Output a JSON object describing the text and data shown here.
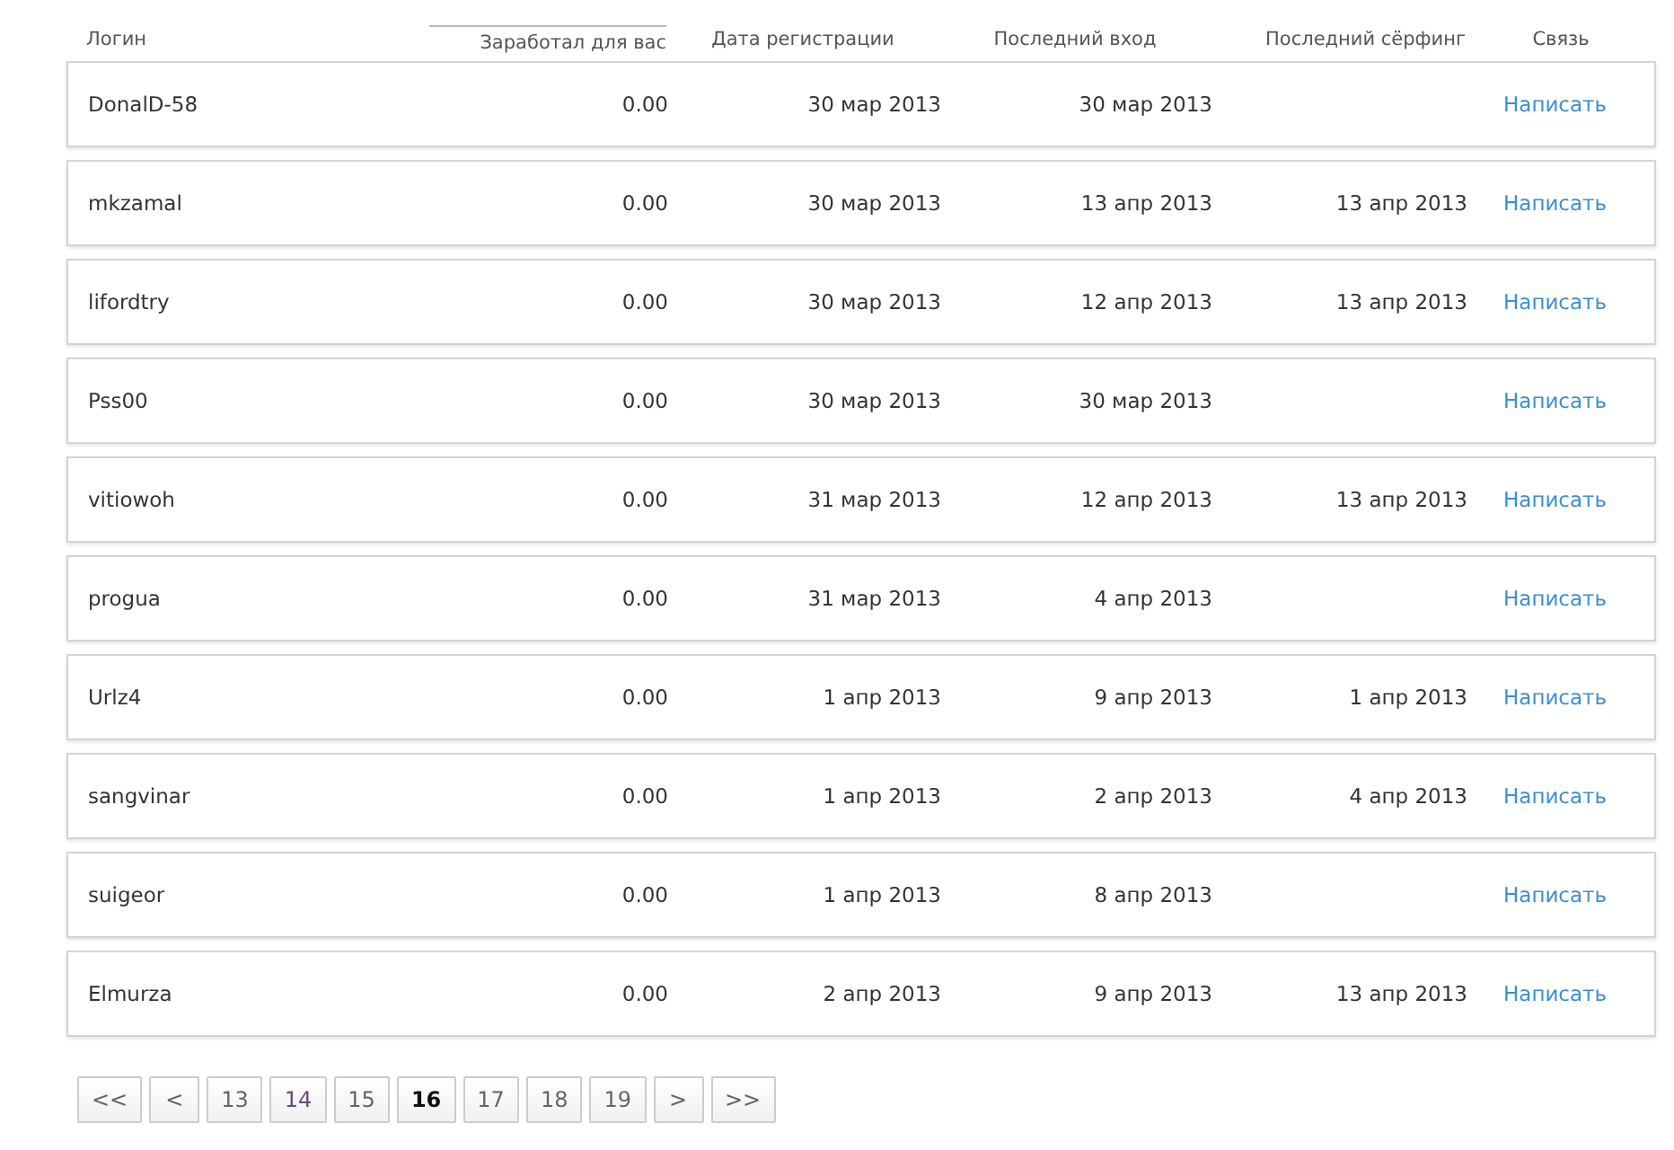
{
  "columns": [
    {
      "label": "Логин",
      "sorted": false
    },
    {
      "label": "Заработал для вас",
      "sorted": true
    },
    {
      "label": "Дата регистрации",
      "sorted": false
    },
    {
      "label": "Последний вход",
      "sorted": false
    },
    {
      "label": "Последний сёрфинг",
      "sorted": false
    },
    {
      "label": "Связь",
      "sorted": false
    }
  ],
  "rows": [
    {
      "login": "DonalD-58",
      "earned": "0.00",
      "registered": "30 мар 2013",
      "last_login": "30 мар 2013",
      "last_surfing": "",
      "contact": "Написать"
    },
    {
      "login": "mkzamal",
      "earned": "0.00",
      "registered": "30 мар 2013",
      "last_login": "13 апр 2013",
      "last_surfing": "13 апр 2013",
      "contact": "Написать"
    },
    {
      "login": "lifordtry",
      "earned": "0.00",
      "registered": "30 мар 2013",
      "last_login": "12 апр 2013",
      "last_surfing": "13 апр 2013",
      "contact": "Написать"
    },
    {
      "login": "Pss00",
      "earned": "0.00",
      "registered": "30 мар 2013",
      "last_login": "30 мар 2013",
      "last_surfing": "",
      "contact": "Написать"
    },
    {
      "login": "vitiowoh",
      "earned": "0.00",
      "registered": "31 мар 2013",
      "last_login": "12 апр 2013",
      "last_surfing": "13 апр 2013",
      "contact": "Написать"
    },
    {
      "login": "progua",
      "earned": "0.00",
      "registered": "31 мар 2013",
      "last_login": "4 апр 2013",
      "last_surfing": "",
      "contact": "Написать"
    },
    {
      "login": "Urlz4",
      "earned": "0.00",
      "registered": "1 апр 2013",
      "last_login": "9 апр 2013",
      "last_surfing": "1 апр 2013",
      "contact": "Написать"
    },
    {
      "login": "sangvinar",
      "earned": "0.00",
      "registered": "1 апр 2013",
      "last_login": "2 апр 2013",
      "last_surfing": "4 апр 2013",
      "contact": "Написать"
    },
    {
      "login": "suigeor",
      "earned": "0.00",
      "registered": "1 апр 2013",
      "last_login": "8 апр 2013",
      "last_surfing": "",
      "contact": "Написать"
    },
    {
      "login": "Elmurza",
      "earned": "0.00",
      "registered": "2 апр 2013",
      "last_login": "9 апр 2013",
      "last_surfing": "13 апр 2013",
      "contact": "Написать"
    }
  ],
  "pagination": [
    {
      "label": "<<",
      "selected": false,
      "visited": false
    },
    {
      "label": "<",
      "selected": false,
      "visited": false
    },
    {
      "label": "13",
      "selected": false,
      "visited": false
    },
    {
      "label": "14",
      "selected": false,
      "visited": true
    },
    {
      "label": "15",
      "selected": false,
      "visited": false
    },
    {
      "label": "16",
      "selected": true,
      "visited": false
    },
    {
      "label": "17",
      "selected": false,
      "visited": false
    },
    {
      "label": "18",
      "selected": false,
      "visited": false
    },
    {
      "label": "19",
      "selected": false,
      "visited": false
    },
    {
      "label": ">",
      "selected": false,
      "visited": false
    },
    {
      "label": ">>",
      "selected": false,
      "visited": false
    }
  ]
}
